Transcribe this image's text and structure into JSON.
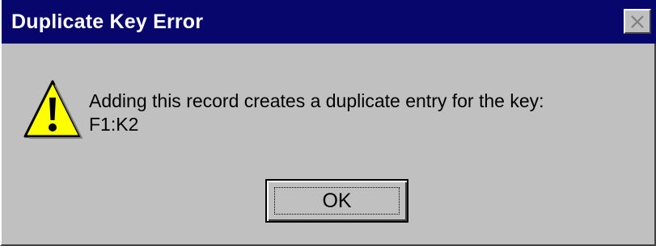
{
  "dialog": {
    "title": "Duplicate Key Error",
    "close_icon": "close-x-icon",
    "icon": "warning-exclamation-icon",
    "message_line1": "Adding this record creates a duplicate entry for the key:",
    "message_line2": "F1:K2",
    "ok_label": "OK"
  },
  "colors": {
    "titlebar": "#06066d",
    "face": "#c0c0c0",
    "warning_fill": "#ffff00"
  }
}
